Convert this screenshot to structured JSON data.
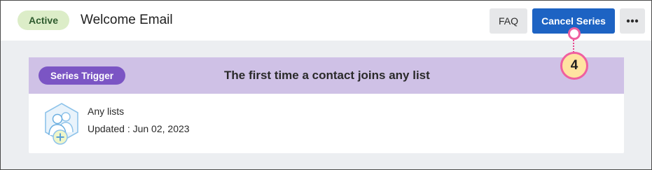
{
  "header": {
    "status": "Active",
    "title": "Welcome Email",
    "faq_label": "FAQ",
    "cancel_label": "Cancel Series",
    "more_icon": "more-horizontal-icon"
  },
  "trigger_card": {
    "badge": "Series Trigger",
    "description": "The first time a contact joins any list",
    "icon": "contacts-add-icon",
    "list_name": "Any lists",
    "updated": "Updated : Jun 02, 2023"
  },
  "callout": {
    "number": "4"
  },
  "colors": {
    "primary": "#1d63c3",
    "status_bg": "#dcedc8",
    "trigger_badge": "#7b55c4",
    "trigger_header": "#cfc1e6",
    "callout_border": "#ef5fa0",
    "callout_fill": "#ffe3a1"
  }
}
